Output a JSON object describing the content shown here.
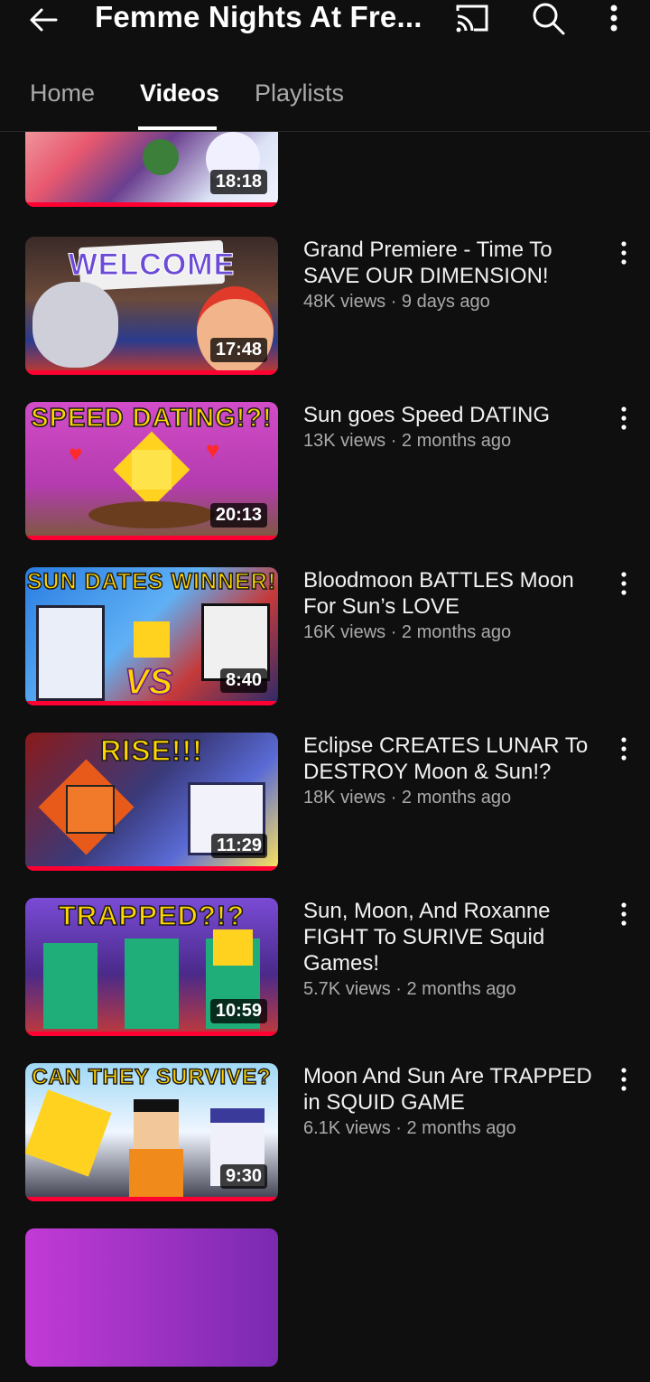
{
  "header": {
    "title": "Femme Nights At Fre...",
    "icons": [
      "back-arrow-icon",
      "cast-icon",
      "search-icon",
      "more-vert-icon"
    ]
  },
  "tabs": [
    {
      "label": "Home",
      "active": false
    },
    {
      "label": "Videos",
      "active": true
    },
    {
      "label": "Playlists",
      "active": false
    }
  ],
  "videos": [
    {
      "duration": "18:18",
      "title": "",
      "stats": "",
      "thumb_caption": ""
    },
    {
      "duration": "17:48",
      "title": "Grand Premiere - Time To SAVE OUR DIMENSION!",
      "stats": "48K views · 9 days ago",
      "thumb_caption": "WELCOME"
    },
    {
      "duration": "20:13",
      "title": "Sun goes Speed DATING",
      "stats": "13K views · 2 months ago",
      "thumb_caption": "SPEED DATING!?!"
    },
    {
      "duration": "8:40",
      "title": "Bloodmoon BATTLES Moon For Sun’s LOVE",
      "stats": "16K views · 2 months ago",
      "thumb_caption": "SUN DATES WINNER!"
    },
    {
      "duration": "11:29",
      "title": "Eclipse CREATES LUNAR To DESTROY Moon & Sun!?",
      "stats": "18K views · 2 months ago",
      "thumb_caption": "RISE!!!"
    },
    {
      "duration": "10:59",
      "title": "Sun, Moon, And Roxanne FIGHT To SURIVE Squid Games!",
      "stats": "5.7K views · 2 months ago",
      "thumb_caption": "TRAPPED?!?"
    },
    {
      "duration": "9:30",
      "title": "Moon And Sun Are TRAPPED in SQUID GAME",
      "stats": "6.1K views · 2 months ago",
      "thumb_caption": "CAN THEY SURVIVE?"
    }
  ],
  "colors": {
    "background": "#0f0f0f",
    "accent": "#ff0033",
    "text_secondary": "#aaaaaa"
  }
}
